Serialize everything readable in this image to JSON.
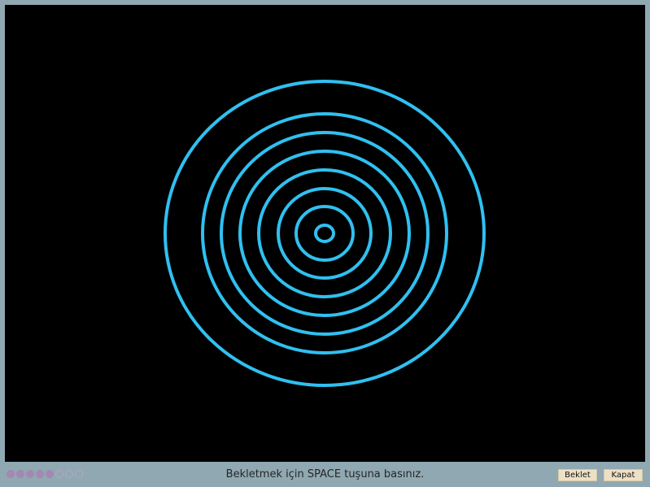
{
  "stage": {
    "background": "#000000",
    "ring_color": "#30c0f0",
    "ring_count": 8
  },
  "footer": {
    "hint": "Bekletmek için SPACE tuşuna basınız.",
    "wait_label": "Beklet",
    "close_label": "Kapat",
    "progress": {
      "filled": 5,
      "total": 8
    }
  }
}
